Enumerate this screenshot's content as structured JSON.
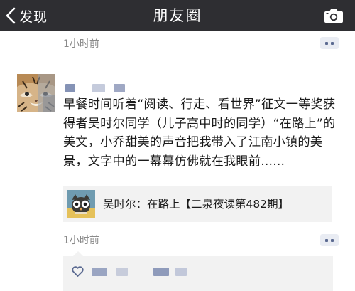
{
  "nav": {
    "back_label": "发现",
    "title": "朋友圈",
    "back_icon": "chevron-left-icon",
    "camera_icon": "camera-icon"
  },
  "previous_post": {
    "time": "1小时前"
  },
  "post": {
    "text": "早餐时间听着“阅读、行走、看世界”征文一等奖获得者吴时尔同学（儿子高中时的同学）“在路上”的美文，小乔甜美的声音把我带入了江南小镇的美景，文字中的一幕幕仿佛就在我眼前......",
    "link": {
      "title": "吴时尔：在路上【二泉夜读第482期】"
    },
    "time": "1小时前"
  },
  "colors": {
    "nav_bg": "#2e2e32",
    "link_bg": "#f2f2f2",
    "name_blue": "#5b6a91",
    "muted_text": "#8a8a8a"
  }
}
